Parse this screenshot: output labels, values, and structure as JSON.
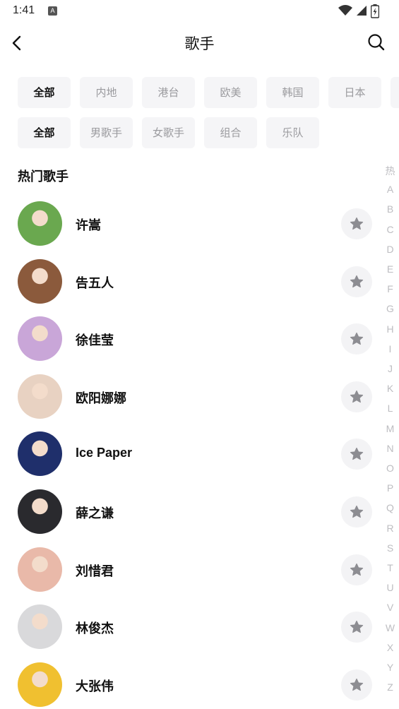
{
  "status_bar": {
    "time": "1:41",
    "notification_badge": "A",
    "icons": [
      "wifi-icon",
      "signal-icon",
      "battery-charging-icon"
    ]
  },
  "header": {
    "title": "歌手",
    "back_icon": "chevron-left-icon",
    "search_icon": "search-icon"
  },
  "region_filters": {
    "selected": "全部",
    "options": [
      "全部",
      "内地",
      "港台",
      "欧美",
      "韩国",
      "日本"
    ]
  },
  "type_filters": {
    "selected": "全部",
    "options": [
      "全部",
      "男歌手",
      "女歌手",
      "组合",
      "乐队"
    ]
  },
  "section_title": "热门歌手",
  "artists": [
    {
      "name": "许嵩",
      "avatar_bg": "#6aa84f"
    },
    {
      "name": "告五人",
      "avatar_bg": "#8b5a3c"
    },
    {
      "name": "徐佳莹",
      "avatar_bg": "#c9a6d8"
    },
    {
      "name": "欧阳娜娜",
      "avatar_bg": "#e8d2c2"
    },
    {
      "name": "Ice Paper",
      "avatar_bg": "#1f2f6b"
    },
    {
      "name": "薛之谦",
      "avatar_bg": "#2a2a2e"
    },
    {
      "name": "刘惜君",
      "avatar_bg": "#e9b9a9"
    },
    {
      "name": "林俊杰",
      "avatar_bg": "#d9d9db"
    },
    {
      "name": "大张伟",
      "avatar_bg": "#f0c030"
    }
  ],
  "follow_icon": "star-icon",
  "index_letters": [
    "热",
    "A",
    "B",
    "C",
    "D",
    "E",
    "F",
    "G",
    "H",
    "I",
    "J",
    "K",
    "L",
    "M",
    "N",
    "O",
    "P",
    "Q",
    "R",
    "S",
    "T",
    "U",
    "V",
    "W",
    "X",
    "Y",
    "Z"
  ],
  "colors": {
    "chip_bg": "#f5f5f7",
    "chip_text": "#9a9a9e",
    "chip_active_text": "#111111",
    "follow_bg": "#f3f3f5",
    "follow_icon": "#8d8d92",
    "index_text": "#bdbdc1"
  }
}
